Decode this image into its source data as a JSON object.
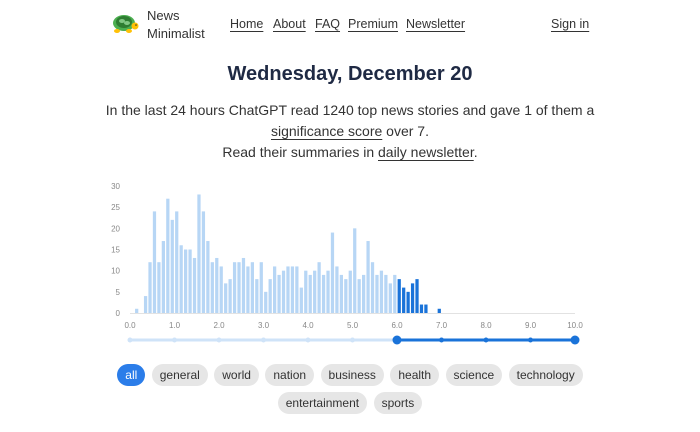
{
  "header": {
    "brand_line1": "News",
    "brand_line2": "Minimalist",
    "nav": {
      "home": "Home",
      "about": "About",
      "faq": "FAQ",
      "premium": "Premium",
      "newsletter": "Newsletter"
    },
    "sign_in": "Sign in"
  },
  "page": {
    "title": "Wednesday, December 20",
    "summary_part1": "In the last 24 hours ChatGPT read 1240 top news stories and gave 1 of them a",
    "significance_link": "significance score",
    "summary_part2": " over 7.",
    "summary_part3": "Read their summaries in ",
    "newsletter_link": "daily newsletter",
    "summary_part4": "."
  },
  "colors": {
    "accent": "#2b7de9",
    "bar_light": "#b7d6f5",
    "bar_dark": "#1a73d9",
    "chip_bg": "#e6e6e6"
  },
  "chart_data": {
    "type": "bar",
    "xlabel": "",
    "ylabel": "",
    "xlim": [
      0,
      10
    ],
    "ylim": [
      0,
      30
    ],
    "y_ticks": [
      "0",
      "5",
      "10",
      "15",
      "20",
      "25",
      "30"
    ],
    "x_ticks": [
      "0.0",
      "1.0",
      "2.0",
      "3.0",
      "4.0",
      "5.0",
      "6.0",
      "7.0",
      "8.0",
      "9.0",
      "10.0"
    ],
    "bin_width": 0.1,
    "bin_starts": [
      0.1,
      0.2,
      0.3,
      0.4,
      0.5,
      0.6,
      0.7,
      0.8,
      0.9,
      1.0,
      1.1,
      1.2,
      1.3,
      1.4,
      1.5,
      1.6,
      1.7,
      1.8,
      1.9,
      2.0,
      2.1,
      2.2,
      2.3,
      2.4,
      2.5,
      2.6,
      2.7,
      2.8,
      2.9,
      3.0,
      3.1,
      3.2,
      3.3,
      3.4,
      3.5,
      3.6,
      3.7,
      3.8,
      3.9,
      4.0,
      4.1,
      4.2,
      4.3,
      4.4,
      4.5,
      4.6,
      4.7,
      4.8,
      4.9,
      5.0,
      5.1,
      5.2,
      5.3,
      5.4,
      5.5,
      5.6,
      5.7,
      5.8,
      5.9,
      6.0,
      6.1,
      6.2,
      6.3,
      6.4,
      6.5,
      6.6,
      6.7,
      6.8,
      6.9
    ],
    "values": [
      1,
      0,
      4,
      12,
      24,
      12,
      17,
      27,
      22,
      24,
      16,
      15,
      15,
      13,
      28,
      24,
      17,
      12,
      13,
      11,
      7,
      8,
      12,
      12,
      13,
      11,
      12,
      8,
      12,
      5,
      8,
      11,
      9,
      10,
      11,
      11,
      11,
      6,
      10,
      9,
      10,
      12,
      9,
      10,
      19,
      11,
      9,
      8,
      10,
      20,
      8,
      9,
      17,
      12,
      9,
      10,
      9,
      7,
      9,
      8,
      6,
      5,
      7,
      8,
      2,
      2,
      0,
      0,
      1
    ],
    "threshold": 6.0,
    "selected_range": [
      6.0,
      10.0
    ]
  },
  "categories": [
    "all",
    "general",
    "world",
    "nation",
    "business",
    "health",
    "science",
    "technology",
    "entertainment",
    "sports"
  ],
  "selected_category": "all"
}
